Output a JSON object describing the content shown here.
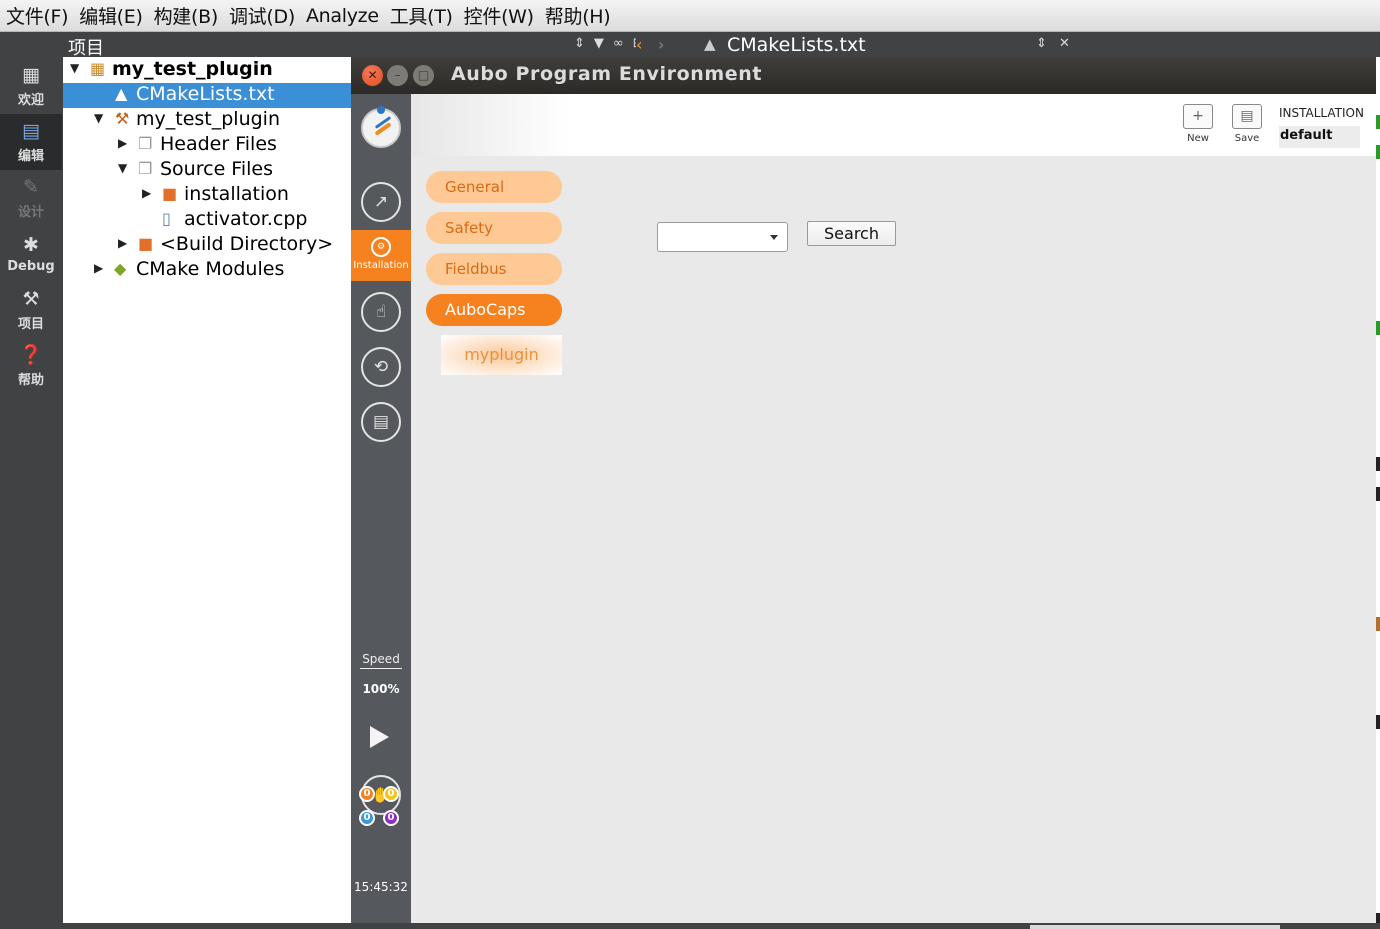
{
  "menubar": {
    "items": [
      "文件(F)",
      "编辑(E)",
      "构建(B)",
      "调试(D)",
      "Analyze",
      "工具(T)",
      "控件(W)",
      "帮助(H)"
    ]
  },
  "modebar": {
    "modes": [
      {
        "label": "欢迎",
        "icon": "grid-icon"
      },
      {
        "label": "编辑",
        "icon": "document-icon"
      },
      {
        "label": "设计",
        "icon": "pencil-icon"
      },
      {
        "label": "Debug",
        "icon": "bug-icon"
      },
      {
        "label": "项目",
        "icon": "wrench-icon"
      },
      {
        "label": "帮助",
        "icon": "help-icon"
      }
    ]
  },
  "project_pane": {
    "title": "项目"
  },
  "editor": {
    "document_name": "CMakeLists.txt"
  },
  "tree": [
    {
      "label": "my_test_plugin",
      "icon": "project-icon",
      "bold": true
    },
    {
      "label": "CMakeLists.txt",
      "icon": "cmake-file-icon",
      "selected": true
    },
    {
      "label": "my_test_plugin",
      "icon": "hammer-icon"
    },
    {
      "label": "Header Files",
      "icon": "header-files-icon"
    },
    {
      "label": "Source Files",
      "icon": "source-files-icon"
    },
    {
      "label": "installation",
      "icon": "folder-icon"
    },
    {
      "label": "activator.cpp",
      "icon": "cpp-file-icon"
    },
    {
      "label": "<Build Directory>",
      "icon": "folder-icon"
    },
    {
      "label": "CMake Modules",
      "icon": "cmake-modules-icon"
    }
  ],
  "aubo": {
    "title": "Aubo Program Environment",
    "sidebar": {
      "install_label": "Installation",
      "speed_label": "Speed",
      "speed_value": "100%",
      "io_indicators": [
        "0",
        "0",
        "0",
        "0"
      ],
      "time": "15:45:32"
    },
    "header": {
      "new_label": "New",
      "save_label": "Save",
      "installation_title": "INSTALLATION",
      "installation_name": "default"
    },
    "nav": {
      "general": "General",
      "safety": "Safety",
      "fieldbus": "Fieldbus",
      "aubocaps": "AuboCaps",
      "myplugin": "myplugin"
    },
    "search": {
      "selected_value": "",
      "button_label": "Search"
    },
    "colors": {
      "accent": "#f6821f",
      "nav_inactive": "#fec994",
      "sidebar": "#55585c"
    }
  }
}
